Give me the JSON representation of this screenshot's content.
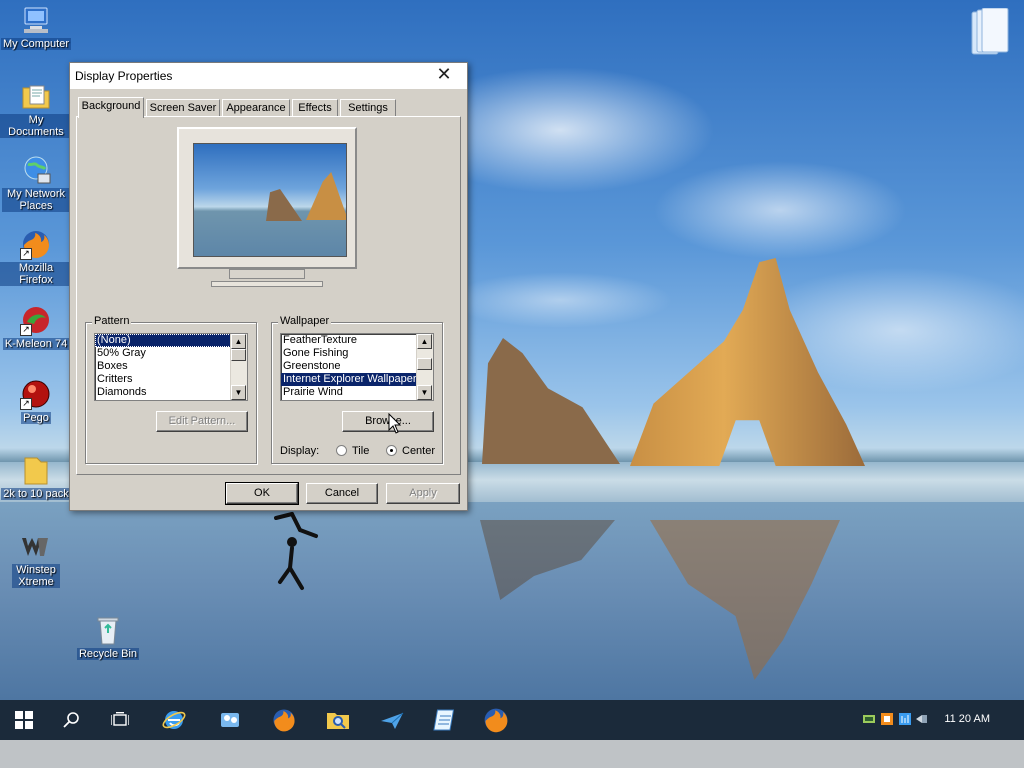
{
  "desktop": {
    "icons": [
      {
        "label": "My Computer"
      },
      {
        "label": "My Documents"
      },
      {
        "label": "My Network Places"
      },
      {
        "label": "Mozilla Firefox"
      },
      {
        "label": "K-Meleon 74"
      },
      {
        "label": "Pego"
      },
      {
        "label": "2k to 10 pack"
      },
      {
        "label": "Winstep Xtreme"
      },
      {
        "label": "Recycle Bin"
      }
    ]
  },
  "dialog": {
    "title": "Display Properties",
    "close": "✕",
    "tabs": [
      "Background",
      "Screen Saver",
      "Appearance",
      "Effects",
      "Settings"
    ],
    "active_tab": "Background",
    "pattern": {
      "label": "Pattern",
      "items": [
        "(None)",
        "50% Gray",
        "Boxes",
        "Critters",
        "Diamonds"
      ],
      "selected": "(None)",
      "edit_button": "Edit Pattern..."
    },
    "wallpaper": {
      "label": "Wallpaper",
      "items": [
        "FeatherTexture",
        "Gone Fishing",
        "Greenstone",
        "Internet Explorer Wallpaper",
        "Prairie Wind"
      ],
      "selected": "Internet Explorer Wallpaper",
      "browse_button": "Browse...",
      "display_label": "Display:",
      "display_options": [
        "Tile",
        "Center"
      ],
      "display_selected": "Center"
    },
    "buttons": {
      "ok": "OK",
      "cancel": "Cancel",
      "apply": "Apply"
    }
  },
  "taskbar": {
    "clock": "11 20 AM",
    "items": [
      "start",
      "search",
      "task-view",
      "internet-explorer",
      "messenger",
      "firefox",
      "search-explorer",
      "paper-plane",
      "notepad",
      "firefox-2"
    ]
  }
}
